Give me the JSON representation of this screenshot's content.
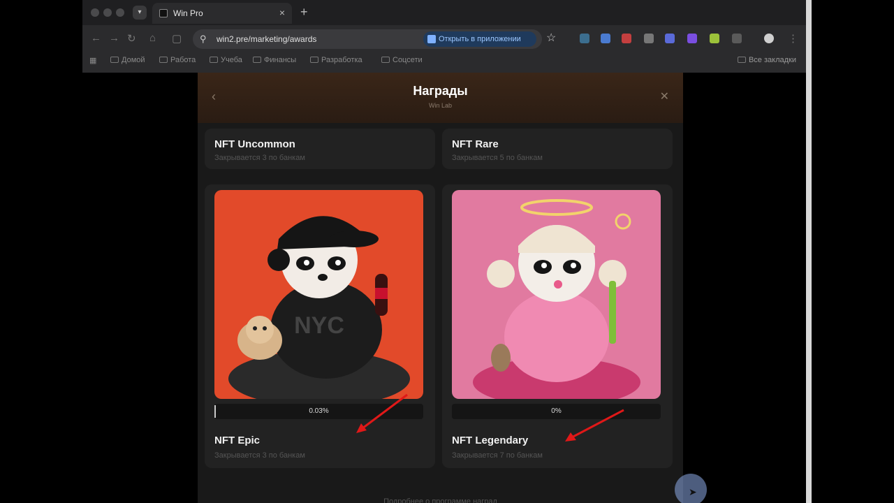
{
  "browser": {
    "tab_title": "Win Pro",
    "new_tab": "+",
    "url": "win2.pre/marketing/awards",
    "open_in_app": "Открыть в приложении",
    "bookmarks": [
      "Домой",
      "Работа",
      "Учеба",
      "Финансы",
      "Разработка",
      "Соцсети"
    ],
    "bookmarks_right": "Все закладки"
  },
  "modal": {
    "title": "Награды",
    "subtitle": "Win Lab",
    "back_icon": "‹",
    "close_icon": "✕"
  },
  "cards": [
    {
      "title": "NFT Uncommon",
      "subtitle": "Закрывается 3 по банкам"
    },
    {
      "title": "NFT Rare",
      "subtitle": "Закрывается 5 по банкам"
    },
    {
      "title": "NFT Epic",
      "subtitle": "Закрывается 3 по банкам",
      "progress_label": "0.03%",
      "progress": 0.0003
    },
    {
      "title": "NFT Legendary",
      "subtitle": "Закрывается 7 по банкам",
      "progress_label": "0%",
      "progress": 0
    }
  ],
  "footer": "Подробнее о программе наград",
  "colors": {
    "header": "#3a2618",
    "epic_bg": "#e24a2a",
    "legendary_bg": "#e17aa0",
    "arrow": "#e01818"
  }
}
